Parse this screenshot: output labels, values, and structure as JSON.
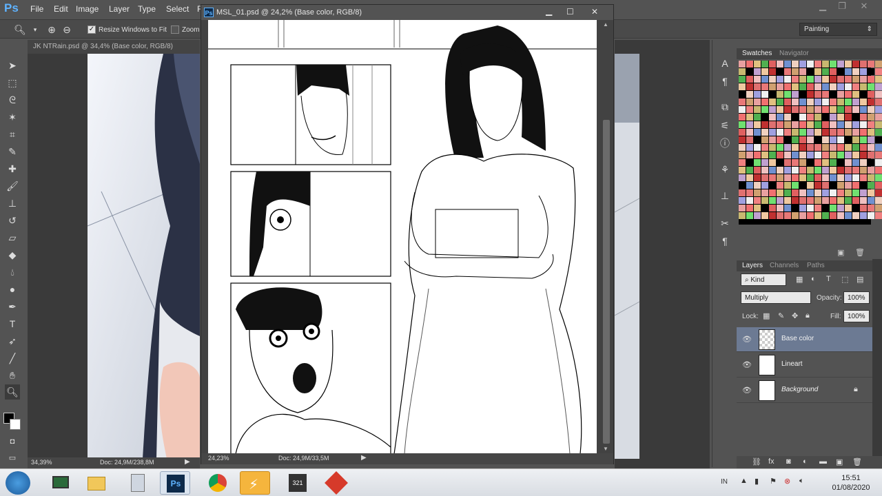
{
  "app": {
    "logo": "Ps"
  },
  "menu": [
    "File",
    "Edit",
    "Image",
    "Layer",
    "Type",
    "Select",
    "F"
  ],
  "options_bar": {
    "resize_windows_label": "Resize Windows to Fit",
    "zoom_label": "Zoom",
    "workspace": "Painting"
  },
  "background_doc": {
    "tab_title": "JK NTRain.psd @ 34,4% (Base color, RGB/8)",
    "zoom": "34,39%",
    "doc_size": "Doc: 24,9M/238,8M"
  },
  "floating_doc": {
    "title": "MSL_01.psd @ 24,2% (Base color, RGB/8)",
    "zoom": "24,23%",
    "doc_size": "Doc: 24,9M/33,5M"
  },
  "swatches_panel": {
    "tabs": [
      "Swatches",
      "Navigator"
    ],
    "colors": [
      "#e8a0a0",
      "#c8b870",
      "#50b050",
      "#f0c8a0",
      "#7090d0",
      "#e87878",
      "#f0f0f0",
      "#f07070",
      "#70e070",
      "#e06060",
      "#c03030",
      "#f0d0c0",
      "#d0a070",
      "#f08080",
      "#e0c080",
      "#c0a0d0",
      "#f0c0c0",
      "#e07070",
      "#a0a0e0"
    ]
  },
  "layers_panel": {
    "tabs": [
      "Layers",
      "Channels",
      "Paths"
    ],
    "filter_kind": "Kind",
    "blend_mode": "Multiply",
    "opacity_label": "Opacity:",
    "opacity_value": "100%",
    "lock_label": "Lock:",
    "fill_label": "Fill:",
    "fill_value": "100%",
    "layers": [
      {
        "name": "Base color",
        "selected": true
      },
      {
        "name": "Lineart",
        "selected": false
      },
      {
        "name": "Background",
        "selected": false,
        "locked": true
      }
    ]
  },
  "taskbar": {
    "language": "IN",
    "time": "15:51",
    "date": "01/08/2020"
  }
}
